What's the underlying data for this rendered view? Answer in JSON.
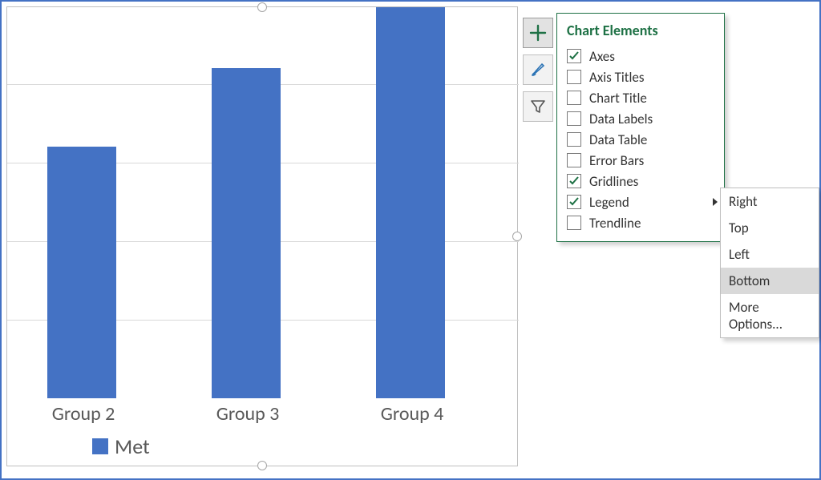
{
  "chart_data": {
    "type": "bar",
    "categories": [
      "Group 2",
      "Group 3",
      "Group 4"
    ],
    "values": [
      3.2,
      4.2,
      5.0
    ],
    "ylim": [
      0,
      6
    ],
    "gridline_interval": 1,
    "series_name": "Met",
    "title": "",
    "xlabel": "",
    "ylabel": "",
    "note": "Chart is cropped; y-axis scale and left edge are off-screen. Values are estimates from gridline positions."
  },
  "legend": {
    "label": "Met"
  },
  "axis_labels": {
    "c0": "Group 2",
    "c1": "Group 3",
    "c2": "Group 4"
  },
  "chart_elements_panel": {
    "title": "Chart Elements",
    "items": [
      {
        "label": "Axes",
        "checked": true
      },
      {
        "label": "Axis Titles",
        "checked": false
      },
      {
        "label": "Chart Title",
        "checked": false
      },
      {
        "label": "Data Labels",
        "checked": false
      },
      {
        "label": "Data Table",
        "checked": false
      },
      {
        "label": "Error Bars",
        "checked": false
      },
      {
        "label": "Gridlines",
        "checked": true
      },
      {
        "label": "Legend",
        "checked": true,
        "has_submenu": true
      },
      {
        "label": "Trendline",
        "checked": false
      }
    ]
  },
  "legend_submenu": {
    "items": [
      {
        "label": "Right"
      },
      {
        "label": "Top"
      },
      {
        "label": "Left"
      },
      {
        "label": "Bottom",
        "selected": true
      },
      {
        "label": "More Options..."
      }
    ]
  },
  "colors": {
    "series": "#4472C4",
    "accent_green": "#1E7145"
  }
}
